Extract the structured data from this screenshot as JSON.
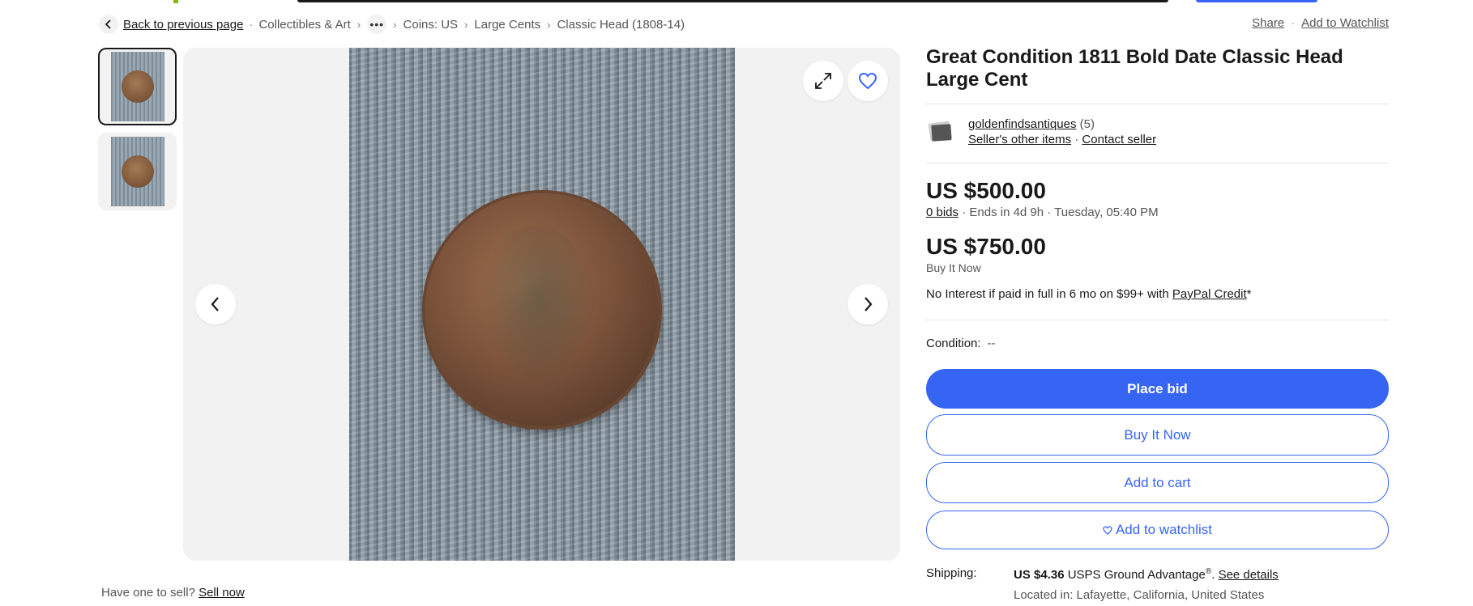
{
  "breadcrumb": {
    "back_label": "Back to previous page",
    "items": [
      "Collectibles & Art",
      "Coins: US",
      "Large Cents",
      "Classic Head (1808-14)"
    ]
  },
  "actions": {
    "share": "Share",
    "add_watchlist": "Add to Watchlist"
  },
  "listing": {
    "title": "Great Condition 1811 Bold Date Classic Head Large Cent"
  },
  "seller": {
    "name": "goldenfindsantiques",
    "feedback": "(5)",
    "other_items": "Seller's other items",
    "contact": "Contact seller"
  },
  "pricing": {
    "current_bid": "US $500.00",
    "bids": "0 bids",
    "ends": "Ends in 4d 9h",
    "end_time": "Tuesday, 05:40 PM",
    "buy_now_price": "US $750.00",
    "buy_now_label": "Buy It Now",
    "credit_text": "No Interest if paid in full in 6 mo on $99+ with ",
    "credit_link": "PayPal Credit",
    "credit_star": "*"
  },
  "condition": {
    "label": "Condition:",
    "value": "--"
  },
  "buttons": {
    "place_bid": "Place bid",
    "buy_now": "Buy It Now",
    "add_cart": "Add to cart",
    "add_watchlist": "Add to watchlist"
  },
  "shipping": {
    "label": "Shipping:",
    "amount": "US $4.36",
    "service": "USPS Ground Advantage",
    "registered": "®",
    "details_link": "See details",
    "location": "Located in: Lafayette, California, United States"
  },
  "sell": {
    "text": "Have one to sell?",
    "link": "Sell now"
  },
  "icons": {
    "back": "chevron-left-icon",
    "more": "more-dots-icon",
    "expand": "expand-icon",
    "heart": "heart-icon",
    "prev": "chevron-left-icon",
    "next": "chevron-right-icon"
  },
  "colors": {
    "primary": "#3665f3",
    "text": "#191919",
    "muted": "#555555"
  }
}
